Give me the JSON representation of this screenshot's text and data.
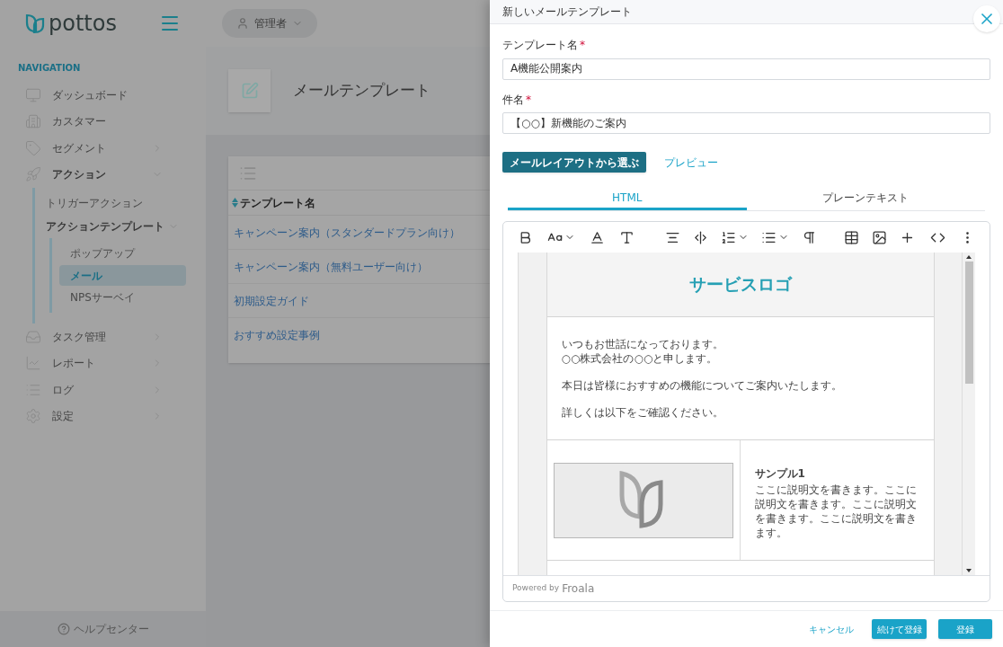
{
  "brand": {
    "name": "pottos"
  },
  "user_menu": {
    "label": "管理者"
  },
  "sidebar": {
    "section": "NAVIGATION",
    "items": [
      {
        "label": "ダッシュボード",
        "expandable": false,
        "expanded": false
      },
      {
        "label": "カスタマー",
        "expandable": false,
        "expanded": false
      },
      {
        "label": "セグメント",
        "expandable": true,
        "expanded": false
      },
      {
        "label": "アクション",
        "expandable": true,
        "expanded": true,
        "children": [
          {
            "label": "トリガーアクション",
            "expandable": false,
            "expanded": false
          },
          {
            "label": "アクションテンプレート",
            "expandable": true,
            "expanded": true,
            "children": [
              {
                "label": "ポップアップ",
                "selected": false
              },
              {
                "label": "メール",
                "selected": true
              },
              {
                "label": "NPSサーベイ",
                "selected": false
              }
            ]
          }
        ]
      },
      {
        "label": "タスク管理",
        "expandable": true,
        "expanded": false
      },
      {
        "label": "レポート",
        "expandable": true,
        "expanded": false
      },
      {
        "label": "ログ",
        "expandable": true,
        "expanded": false
      },
      {
        "label": "設定",
        "expandable": true,
        "expanded": false
      }
    ],
    "help": "ヘルプセンター"
  },
  "page": {
    "title": "メールテンプレート"
  },
  "table": {
    "columns": [
      "テンプレート名"
    ],
    "rows": [
      [
        "キャンペーン案内（スタンダードプラン向け）"
      ],
      [
        "キャンペーン案内（無料ユーザー向け）"
      ],
      [
        "初期設定ガイド"
      ],
      [
        "おすすめ設定事例"
      ]
    ]
  },
  "drawer": {
    "title": "新しいメールテンプレート",
    "fields": [
      {
        "label": "テンプレート名",
        "required_mark": "*",
        "value": "A機能公開案内"
      },
      {
        "label": "件名",
        "required_mark": "*",
        "value": "【○○】新機能のご案内"
      }
    ],
    "layout_button": "メールレイアウトから選ぶ",
    "preview_link": "プレビュー",
    "tabs": [
      {
        "label": "HTML",
        "selected": true
      },
      {
        "label": "プレーンテキスト",
        "selected": false
      }
    ],
    "editor": {
      "logo_text": "サービスロゴ",
      "paragraphs": [
        "いつもお世話になっております。\n○○株式会社の○○と申します。",
        "本日は皆様におすすめの機能についてご案内いたします。",
        "詳しくは以下をご確認ください。"
      ],
      "sample": {
        "title": "サンプル1",
        "text": "ここに説明文を書きます。ここに説明文を書きます。ここに説明文を書きます。ここに説明文を書きます。"
      },
      "powered_by": "Powered by",
      "powered_brand": "Froala"
    },
    "actions": {
      "cancel": "キャンセル",
      "save_continue": "続けて登録",
      "save": "登録"
    }
  }
}
